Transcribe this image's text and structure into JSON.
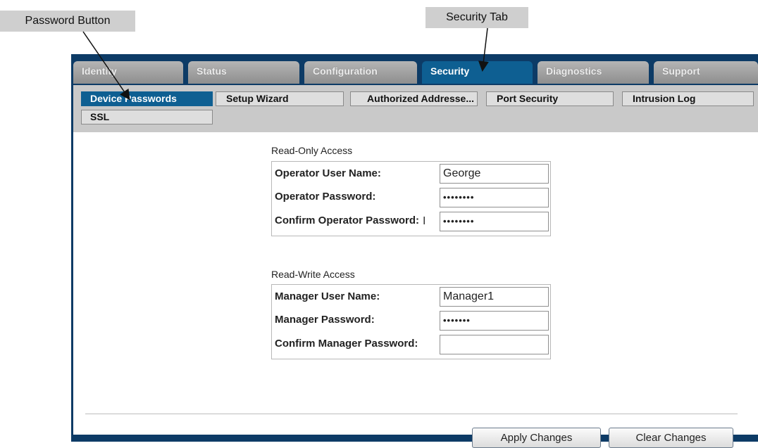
{
  "annotations": {
    "password_button": "Password Button",
    "security_tab": "Security Tab"
  },
  "tabs": [
    {
      "label": "Identity",
      "active": false
    },
    {
      "label": "Status",
      "active": false
    },
    {
      "label": "Configuration",
      "active": false
    },
    {
      "label": "Security",
      "active": true
    },
    {
      "label": "Diagnostics",
      "active": false
    },
    {
      "label": "Support",
      "active": false
    }
  ],
  "subnav": [
    {
      "label": "Device Passwords",
      "active": true
    },
    {
      "label": "Setup Wizard",
      "active": false
    },
    {
      "label": "Authorized Addresse...",
      "active": false
    },
    {
      "label": "Port Security",
      "active": false
    },
    {
      "label": "Intrusion Log",
      "active": false
    },
    {
      "label": "SSL",
      "active": false
    }
  ],
  "read_only": {
    "title": "Read-Only Access",
    "user_label": "Operator User Name:",
    "user_value": "George",
    "password_label": "Operator Password:",
    "password_value": "••••••••",
    "confirm_label": "Confirm Operator Password:",
    "confirm_value": "••••••••"
  },
  "read_write": {
    "title": "Read-Write Access",
    "user_label": "Manager User Name:",
    "user_value": "Manager1",
    "password_label": "Manager Password:",
    "password_value": "•••••••",
    "confirm_label": "Confirm Manager Password:",
    "confirm_value": ""
  },
  "buttons": {
    "apply": "Apply Changes",
    "clear": "Clear Changes"
  },
  "colors": {
    "frame": "#0d3b66",
    "active_tab": "#0e5f92",
    "inactive_tab": "#a3a3a3",
    "subnav_bg": "#c9c9c9"
  }
}
